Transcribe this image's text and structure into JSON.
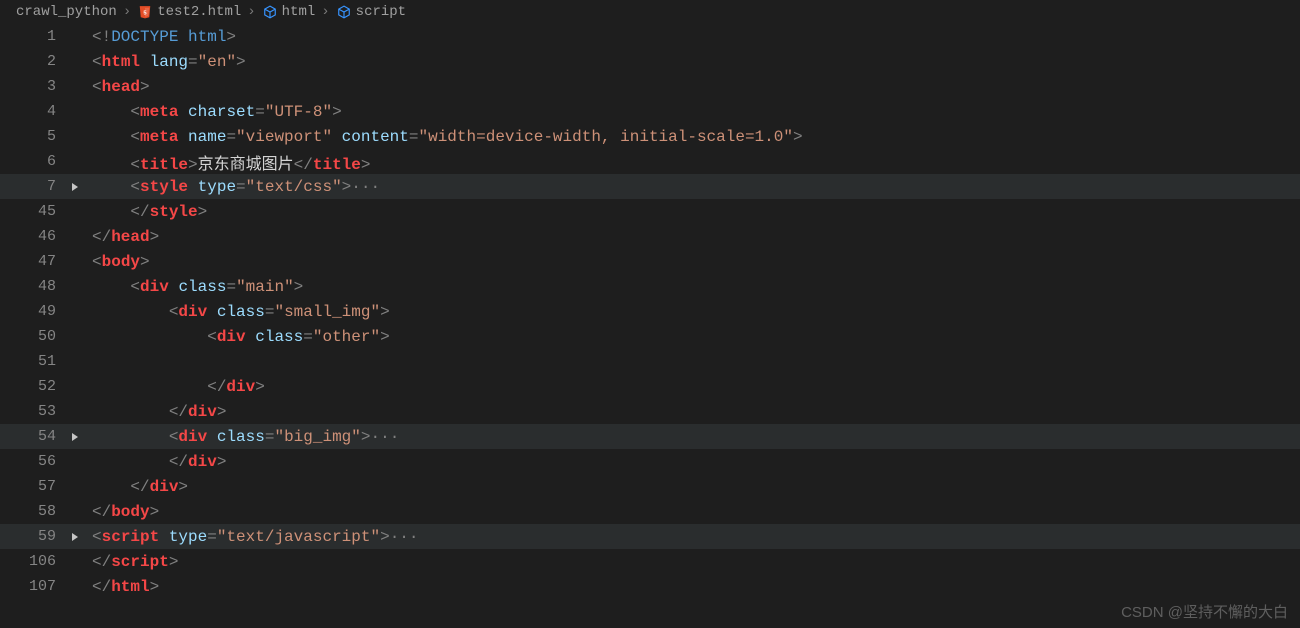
{
  "breadcrumb": {
    "seg0": "crawl_python",
    "seg1": "test2.html",
    "seg2": "html",
    "seg3": "script"
  },
  "lines": {
    "n1": "1",
    "n2": "2",
    "n3": "3",
    "n4": "4",
    "n5": "5",
    "n6": "6",
    "n7": "7",
    "n45": "45",
    "n46": "46",
    "n47": "47",
    "n48": "48",
    "n49": "49",
    "n50": "50",
    "n51": "51",
    "n52": "52",
    "n53": "53",
    "n54": "54",
    "n56": "56",
    "n57": "57",
    "n58": "58",
    "n59": "59",
    "n106": "106",
    "n107": "107"
  },
  "tokens": {
    "doctype_open": "<!",
    "lt": "<",
    "gt": ">",
    "lts": "</",
    "eq": "=",
    "DOCTYPE": "DOCTYPE ",
    "html": "html",
    "lang": "lang",
    "en": "\"en\"",
    "head": "head",
    "meta": "meta",
    "charset": "charset",
    "utf8": "\"UTF-8\"",
    "name": "name",
    "viewport": "\"viewport\"",
    "content": "content",
    "viewport_content": "\"width=device-width, initial-scale=1.0\"",
    "title": "title",
    "title_text": "京东商城图片",
    "style": "style",
    "type": "type",
    "textcss": "\"text/css\"",
    "body": "body",
    "div": "div",
    "class": "class",
    "main": "\"main\"",
    "small_img": "\"small_img\"",
    "other": "\"other\"",
    "big_img": "\"big_img\"",
    "script": "script",
    "textjs": "\"text/javascript\"",
    "dots": "···"
  },
  "watermark": "CSDN @坚持不懈的大白"
}
